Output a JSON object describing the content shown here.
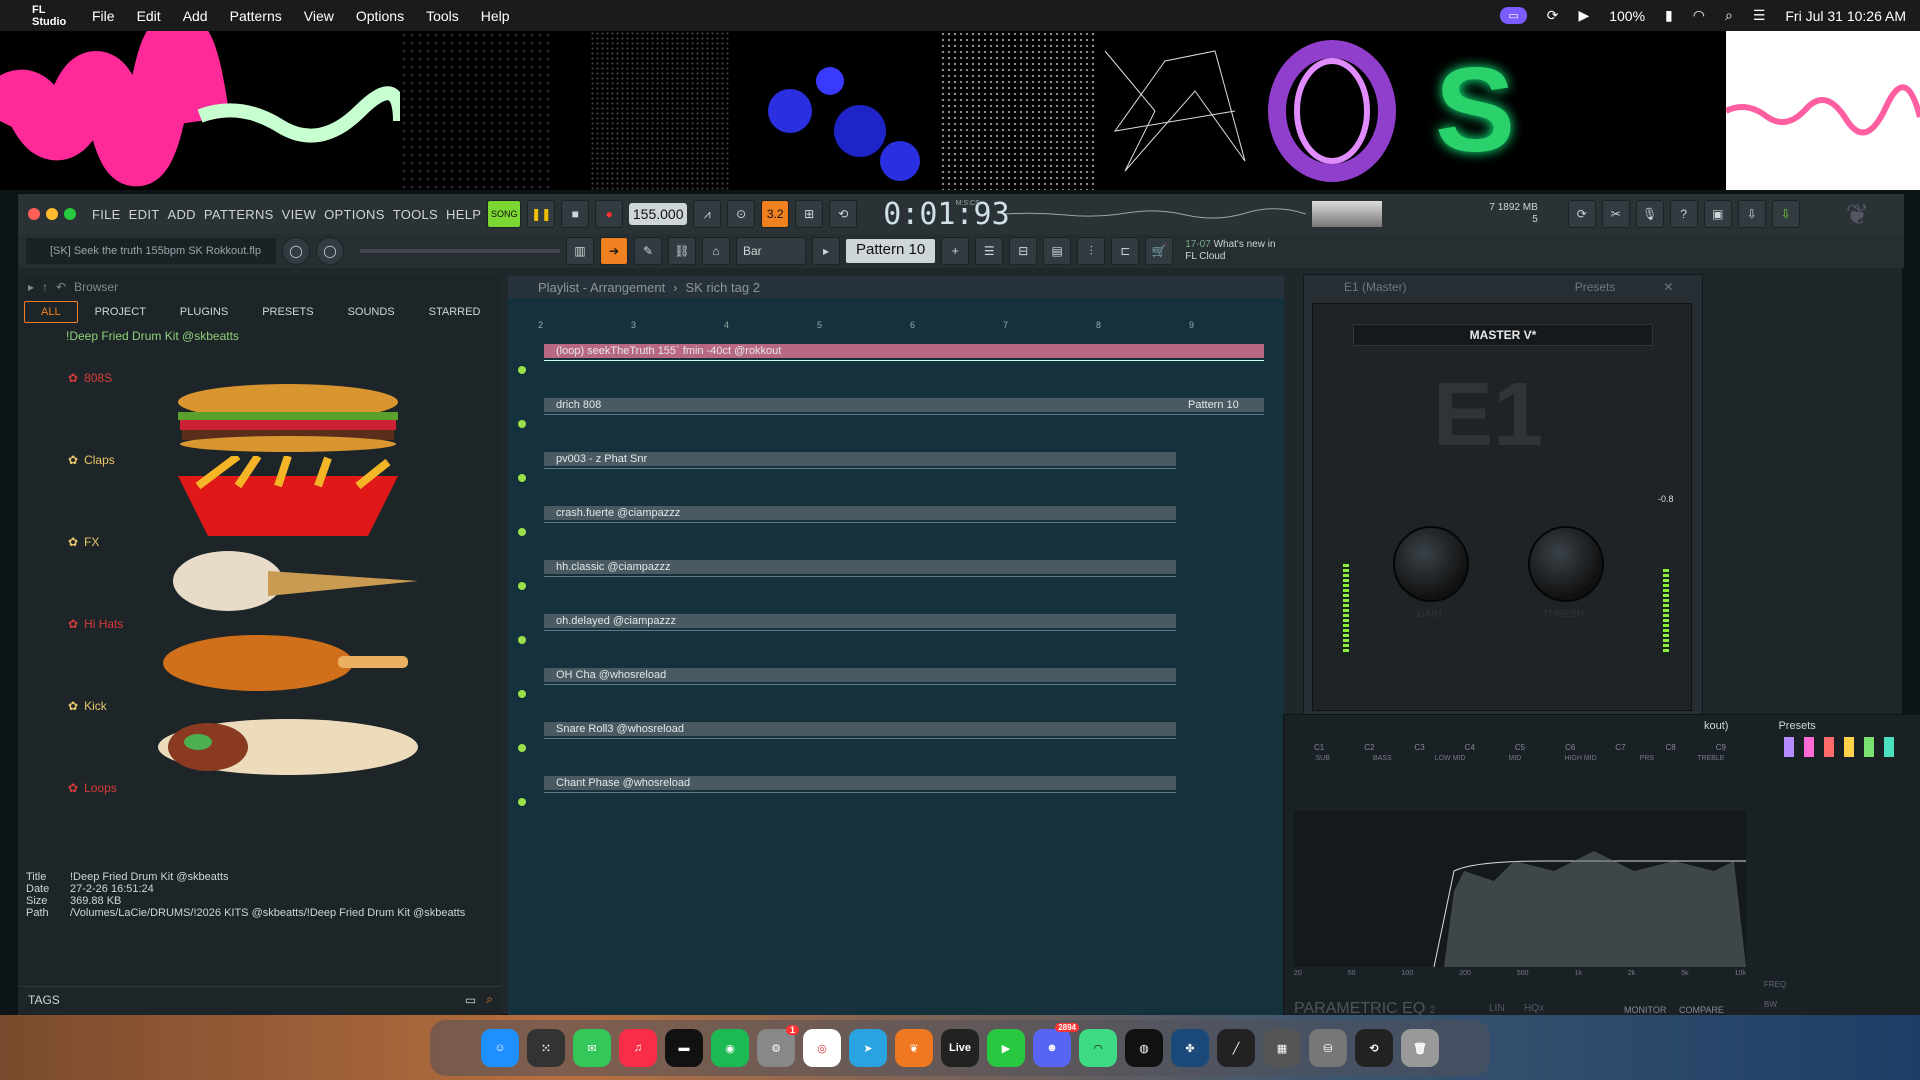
{
  "menubar": {
    "app": "FL Studio",
    "items": [
      "File",
      "Edit",
      "Add",
      "Patterns",
      "View",
      "Options",
      "Tools",
      "Help"
    ],
    "battery": "100%",
    "datetime": "Fri Jul 31  10:26 AM"
  },
  "fl": {
    "menu": [
      "FILE",
      "EDIT",
      "ADD",
      "PATTERNS",
      "VIEW",
      "OPTIONS",
      "TOOLS",
      "HELP"
    ],
    "mode": "SONG",
    "tempo": "155.000",
    "time": "0:01:93",
    "time_label": "M:S:CS",
    "cpu": "7",
    "ram": "1892 MB",
    "poly": "5",
    "hint": "[SK] Seek the truth 155bpm SK Rokkout.flp",
    "snap": "Bar",
    "pattern": "Pattern 10",
    "news_date": "17-07",
    "news_title": "What's new in",
    "news_sub": "FL Cloud"
  },
  "browser": {
    "title": "Browser",
    "tabs": [
      "ALL",
      "PROJECT",
      "PLUGINS",
      "PRESETS",
      "SOUNDS",
      "STARRED"
    ],
    "root": "!Deep Fried Drum Kit @skbeatts",
    "categories": [
      "808S",
      "Claps",
      "FX",
      "Hi Hats",
      "Kick",
      "Loops"
    ],
    "info": {
      "title_k": "Title",
      "title_v": "!Deep Fried Drum Kit @skbeatts",
      "date_k": "Date",
      "date_v": "27-2-26 16:51:24",
      "size_k": "Size",
      "size_v": "369.88 KB",
      "path_k": "Path",
      "path_v": "/Volumes/LaCie/DRUMS/!2026 KITS @skbeatts/!Deep Fried Drum Kit @skbeatts"
    },
    "tags": "TAGS"
  },
  "playlist": {
    "title": "Playlist - Arrangement",
    "crumb": "SK rich tag 2",
    "ruler": [
      "2",
      "3",
      "4",
      "5",
      "6",
      "7",
      "8",
      "9"
    ],
    "tracks": [
      "(loop) seekTheTruth 155` fmin -40ct @rokkout",
      "drich 808",
      "pv003 - z Phat Snr",
      "crash.fuerte @ciampazzz",
      "hh.classic @ciampazzz",
      "oh.delayed @ciampazzz",
      "OH Cha @whosreload",
      "Snare Roll3 @whosreload",
      "Chant Phase @whosreload"
    ],
    "pattern_clip": "Pattern 10"
  },
  "e1": {
    "title": "E1 (Master)",
    "presets": "Presets",
    "preset_name": "MASTER V*",
    "logo": "E1",
    "gain": "GAIN",
    "thresh": "THRESH",
    "level_right": "-0.8"
  },
  "eq": {
    "presets": "Presets",
    "partial": "kout)",
    "bands": [
      "C1",
      "C2",
      "C3",
      "C4",
      "C5",
      "C6",
      "C7",
      "C8",
      "C9"
    ],
    "ranges": [
      "SUB",
      "BASS",
      "LOW MID",
      "MID",
      "HIGH MID",
      "PRS",
      "TREBLE"
    ],
    "freqs": [
      "20",
      "50",
      "100",
      "200",
      "500",
      "1k",
      "2k",
      "5k",
      "10k"
    ],
    "db": [
      "18",
      "12",
      "6",
      "0",
      "6",
      "12",
      "18"
    ],
    "title": "PARAMETRIC EQ",
    "ver": "2",
    "lin": "LIN",
    "hq": "HQx",
    "monitor": "MONITOR",
    "compare": "COMPARE",
    "freq": "FREQ",
    "bw": "BW"
  },
  "dock": {
    "live": "Live",
    "badge_sys": "1",
    "badge_discord": "2894"
  }
}
